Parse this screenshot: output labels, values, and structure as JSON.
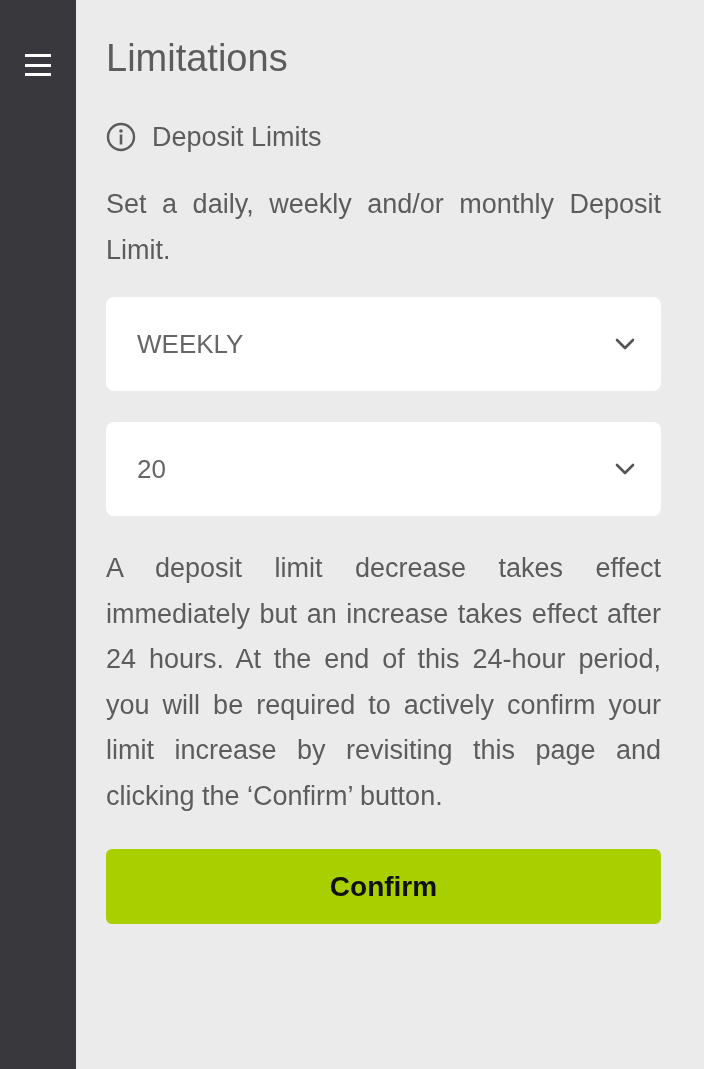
{
  "sidebar": {
    "menu": true
  },
  "title": "Limitations",
  "section": {
    "label": "Deposit Limits"
  },
  "intro": "Set a daily, weekly and/or monthly Deposit Limit.",
  "selects": [
    {
      "value": "WEEKLY"
    },
    {
      "value": "20"
    }
  ],
  "notice": "A deposit limit decrease takes effect immediately but an increase takes effect after 24 hours. At the end of this 24-hour period, you will be required to actively confirm your limit increase by revisiting this page and clicking the ‘Confirm’ button.",
  "button": "Confirm"
}
